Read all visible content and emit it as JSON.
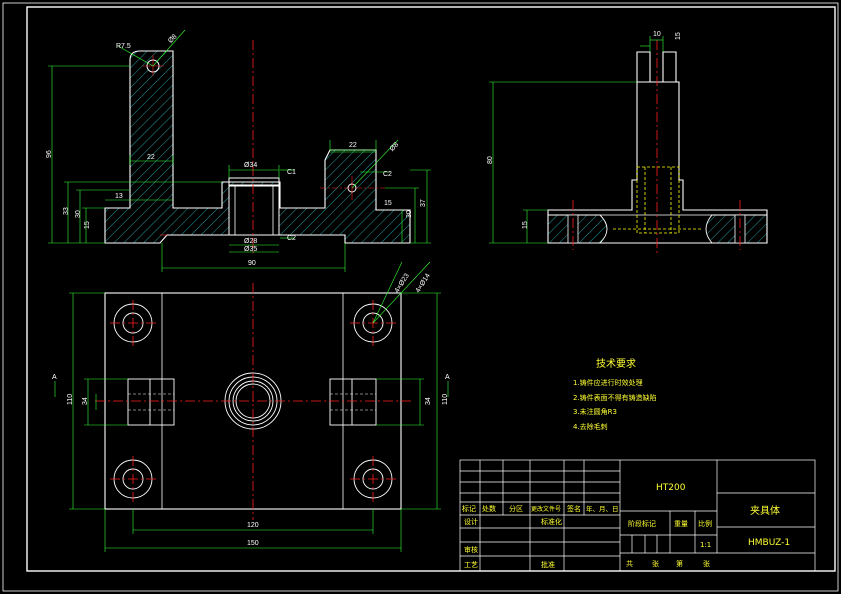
{
  "colors": {
    "background": "#000000",
    "outline": "#ffffff",
    "centerline": "#ff2020",
    "dimension": "#33ff33",
    "hatch": "#33dddd",
    "hidden": "#ffff00",
    "text": "#ffff33"
  },
  "front_view": {
    "dims": {
      "r": "R7.5",
      "hole_top": "Ø8",
      "width_top": "22",
      "total_h": "96",
      "h33": "33",
      "h30": "30",
      "h15": "15",
      "w13": "13",
      "bore_top": "Ø34",
      "bore": "Ø28",
      "bore_low": "Ø35",
      "c1": "C1",
      "c2": "C2",
      "w90": "90",
      "w22": "22",
      "hole_right": "Ø8",
      "chamf": "C2",
      "h15r": "15",
      "h30r": "30",
      "h37": "37"
    }
  },
  "side_view": {
    "dims": {
      "slot": "10",
      "slot_h": "15",
      "h80": "80",
      "h15": "15"
    }
  },
  "top_view": {
    "dims": {
      "hole_a": "4×Ø23",
      "hole_b": "4×Ø14",
      "h110": "110",
      "h34": "34",
      "w120": "120",
      "w150": "150",
      "h34r": "34",
      "h110r": "110"
    },
    "section_labels": [
      "A",
      "A"
    ]
  },
  "tech_requirements": {
    "title": "技术要求",
    "items": [
      "1.铸件应进行时效处理",
      "2.铸件表面不得有铸造缺陷",
      "3.未注圆角R3",
      "4.去除毛刺"
    ]
  },
  "title_block": {
    "material": "HT200",
    "part_name": "夹具体",
    "drawing_no": "HMBUZ-1",
    "header_labels": [
      "标记",
      "处数",
      "分区",
      "更改文件号",
      "签名",
      "年、月、日"
    ],
    "design": "设计",
    "standardization": "标准化",
    "review": "审核",
    "process": "工艺",
    "approve": "批准",
    "stage_mark": "阶段标记",
    "weight": "重量",
    "scale": "比例",
    "scale_value": "1:1",
    "sheets_total": "共",
    "sheet_label": "张",
    "sheet_no": "第",
    "sheet_label2": "张"
  }
}
